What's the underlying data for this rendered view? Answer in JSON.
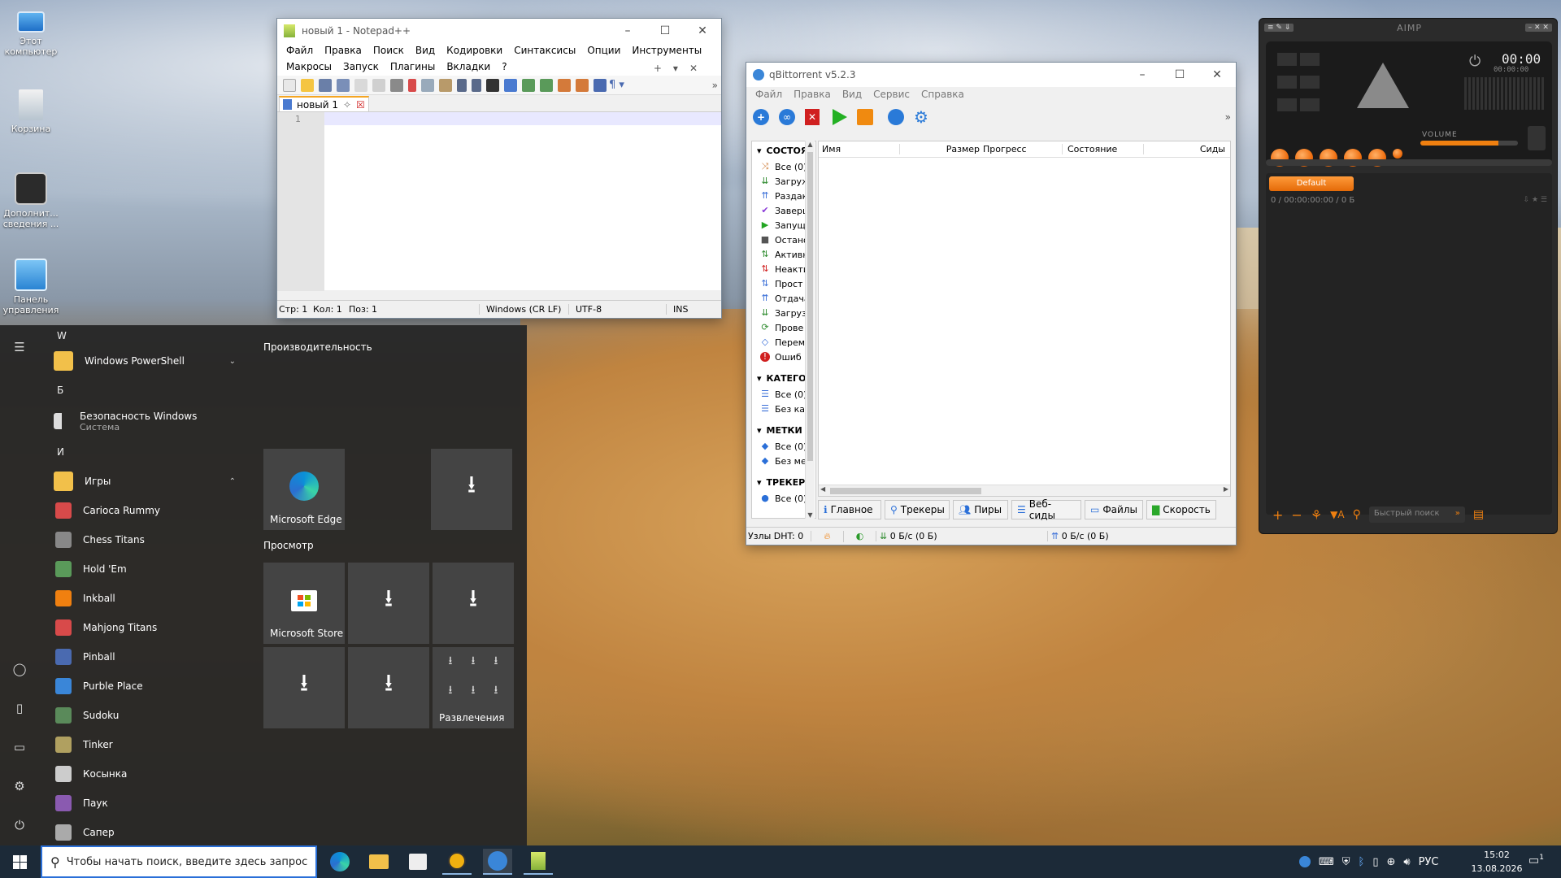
{
  "desktop": {
    "icons": [
      {
        "label": "Этот компьютер"
      },
      {
        "label": "Корзина"
      },
      {
        "label": "Дополнит... сведения ..."
      },
      {
        "label": "Панель управления"
      }
    ]
  },
  "notepad": {
    "title": "новый 1 - Notepad++",
    "menu_row1": [
      "Файл",
      "Правка",
      "Поиск",
      "Вид",
      "Кодировки",
      "Синтаксисы",
      "Опции",
      "Инструменты"
    ],
    "menu_row2": [
      "Макросы",
      "Запуск",
      "Плагины",
      "Вкладки",
      "?"
    ],
    "tab_label": "новый 1",
    "line_number": "1",
    "status": {
      "line": "Стр: 1",
      "col": "Кол: 1",
      "pos": "Поз: 1",
      "eol": "Windows (CR LF)",
      "encoding": "UTF-8",
      "mode": "INS"
    }
  },
  "qbittorrent": {
    "title": "qBittorrent v5.2.3",
    "menu": [
      "Файл",
      "Правка",
      "Вид",
      "Сервис",
      "Справка"
    ],
    "status_section": "СОСТОЯ",
    "status_items": [
      {
        "label": "Все (0)",
        "icon": "shuffle-icon",
        "color": "#d08040"
      },
      {
        "label": "Загруж",
        "icon": "download-icon",
        "color": "#2e8b2e"
      },
      {
        "label": "Раздак",
        "icon": "upload-icon",
        "color": "#3a6fd8"
      },
      {
        "label": "Заверш",
        "icon": "check-icon",
        "color": "#8a3ad8"
      },
      {
        "label": "Запущ",
        "icon": "play-icon",
        "color": "#23a523"
      },
      {
        "label": "Остано",
        "icon": "stop-icon",
        "color": "#555555"
      },
      {
        "label": "Активн",
        "icon": "active-icon",
        "color": "#2e8b2e"
      },
      {
        "label": "Неакти",
        "icon": "inactive-icon",
        "color": "#d02020"
      },
      {
        "label": "Прост",
        "icon": "stalled-icon",
        "color": "#3a6fd8"
      },
      {
        "label": "Отдача",
        "icon": "seeding-icon",
        "color": "#3a6fd8"
      },
      {
        "label": "Загруз",
        "icon": "downloading-icon",
        "color": "#2e8b2e"
      },
      {
        "label": "Прове",
        "icon": "refresh-icon",
        "color": "#2e8b2e"
      },
      {
        "label": "Перем",
        "icon": "moving-icon",
        "color": "#3a6fd8"
      },
      {
        "label": "Ошиб",
        "icon": "error-icon",
        "color": "#d02020"
      }
    ],
    "categories_section": "КАТЕГО",
    "category_items": [
      "Все (0)",
      "Без кат"
    ],
    "tags_section": "МЕТКИ",
    "tag_items": [
      "Все (0)",
      "Без ме"
    ],
    "trackers_section": "ТРЕКЕР",
    "tracker_items": [
      "Все (0)"
    ],
    "columns": [
      "Имя",
      "Размер",
      "Прогресс",
      "Состояние",
      "Сиды"
    ],
    "tabs": [
      "Главное",
      "Трекеры",
      "Пиры",
      "Веб-сиды",
      "Файлы",
      "Скорость"
    ],
    "statusbar": {
      "dht": "Узлы DHT: 0",
      "down": "0 Б/с (0 Б)",
      "up": "0 Б/с (0 Б)"
    }
  },
  "aimp": {
    "title": "AIMP",
    "time": "00:00",
    "time_small": "00:00:00",
    "volume_label": "VOLUME",
    "playlist_tab": "Default",
    "playlist_info": "0 / 00:00:00:00 / 0 Б",
    "search_placeholder": "Быстрый поиск"
  },
  "start_menu": {
    "groups": [
      {
        "letter": "W",
        "apps": [
          {
            "label": "Windows PowerShell",
            "sub": "",
            "expand": "⌄"
          }
        ]
      },
      {
        "letter": "Б",
        "apps": [
          {
            "label": "Безопасность Windows",
            "sub": "Система"
          }
        ]
      },
      {
        "letter": "И",
        "apps": [
          {
            "label": "Игры",
            "expand": "⌃"
          }
        ]
      }
    ],
    "games": [
      "Carioca Rummy",
      "Chess Titans",
      "Hold 'Em",
      "Inkball",
      "Mahjong Titans",
      "Pinball",
      "Purble Place",
      "Sudoku",
      "Tinker",
      "Косынка",
      "Паук",
      "Сапер"
    ],
    "tile_groups": {
      "productivity": "Производительность",
      "browse": "Просмотр"
    },
    "tiles": {
      "edge": "Microsoft Edge",
      "store": "Microsoft Store",
      "entertainment": "Развлечения"
    }
  },
  "taskbar": {
    "search_placeholder": "Чтобы начать поиск, введите здесь запрос",
    "lang": "РУС",
    "time": "15:02",
    "date": "13.08.2026",
    "notification_count": "1"
  }
}
